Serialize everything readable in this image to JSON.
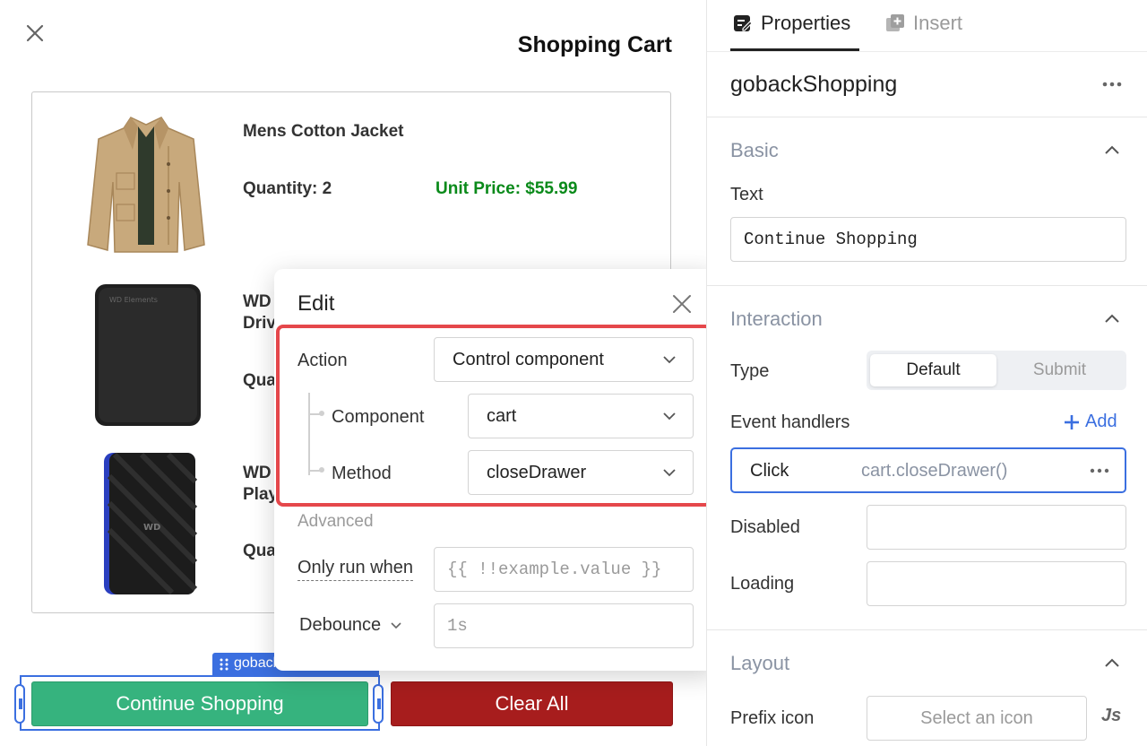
{
  "canvas": {
    "title": "Shopping Cart",
    "items": [
      {
        "name": "Mens Cotton Jacket",
        "quantity": "Quantity: 2",
        "price": "Unit Price: $55.99"
      },
      {
        "name": "WD\nDriv",
        "quantity": "Qua"
      },
      {
        "name": "WD\nPlay",
        "quantity": "Qua"
      }
    ],
    "selected_tag": "gobackShopping",
    "continue_label": "Continue Shopping",
    "clear_label": "Clear All"
  },
  "edit": {
    "title": "Edit",
    "action_label": "Action",
    "action_value": "Control component",
    "component_label": "Component",
    "component_value": "cart",
    "method_label": "Method",
    "method_value": "closeDrawer",
    "advanced_label": "Advanced",
    "only_run_label": "Only run when",
    "only_run_placeholder": "{{ !!example.value }}",
    "debounce_label": "Debounce",
    "debounce_value": "1s"
  },
  "panel": {
    "tabs": [
      {
        "label": "Properties",
        "icon": "properties-icon",
        "active": true
      },
      {
        "label": "Insert",
        "icon": "insert-icon",
        "active": false
      }
    ],
    "component_name": "gobackShopping",
    "basic": {
      "title": "Basic",
      "text_label": "Text",
      "text_value": "Continue Shopping"
    },
    "interaction": {
      "title": "Interaction",
      "type_label": "Type",
      "type_options": [
        "Default",
        "Submit"
      ],
      "type_selected": "Default",
      "event_handlers_label": "Event handlers",
      "add_label": "Add",
      "handler_event": "Click",
      "handler_action": "cart.closeDrawer()",
      "disabled_label": "Disabled",
      "loading_label": "Loading"
    },
    "layout": {
      "title": "Layout",
      "prefix_icon_label": "Prefix icon",
      "prefix_icon_placeholder": "Select an icon",
      "js_label": "Js"
    }
  },
  "colors": {
    "accent": "#3b6fe0",
    "highlight": "#e5474b",
    "continue_bg": "#36b37e",
    "clear_bg": "#a71d1d",
    "price": "#0a8a1a"
  }
}
